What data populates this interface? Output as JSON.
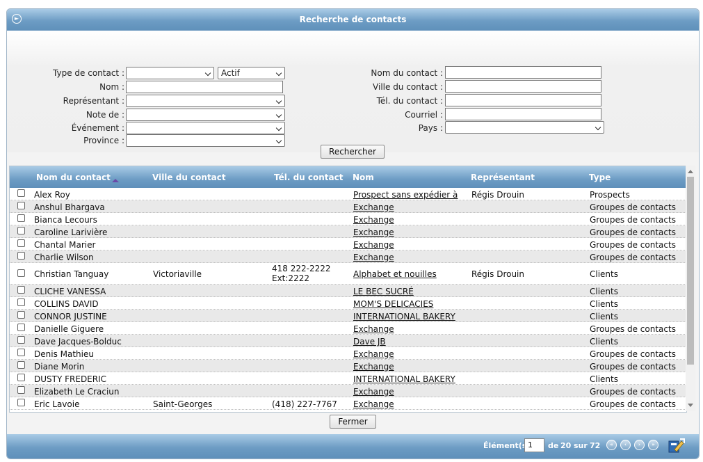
{
  "title": "Recherche de contacts",
  "form": {
    "type_label": "Type de contact :",
    "type_value": "",
    "status_value": "Actif",
    "nom_label": "Nom :",
    "nom_value": "",
    "rep_label": "Représentant :",
    "rep_value": "",
    "note_label": "Note de :",
    "note_value": "",
    "event_label": "Événement :",
    "event_value": "",
    "province_label": "Province :",
    "province_value": "",
    "contact_name_label": "Nom du contact :",
    "contact_name_value": "",
    "city_label": "Ville du contact :",
    "city_value": "",
    "phone_label": "Tél. du contact :",
    "phone_value": "",
    "email_label": "Courriel :",
    "email_value": "",
    "country_label": "Pays :",
    "country_value": "",
    "search_button": "Rechercher"
  },
  "grid": {
    "columns": [
      "Nom du contact",
      "Ville du contact",
      "Tél. du contact",
      "Nom",
      "Représentant",
      "Type"
    ],
    "rows": [
      {
        "contact": "Alex Roy",
        "city": "",
        "phone": "",
        "phone2": "",
        "nom": "Prospect sans expédier à",
        "rep": "Régis Drouin",
        "type": "Prospects"
      },
      {
        "contact": "Anshul Bhargava",
        "city": "",
        "phone": "",
        "phone2": "",
        "nom": "Exchange",
        "rep": "",
        "type": "Groupes de contacts"
      },
      {
        "contact": "Bianca Lecours",
        "city": "",
        "phone": "",
        "phone2": "",
        "nom": "Exchange",
        "rep": "",
        "type": "Groupes de contacts"
      },
      {
        "contact": "Caroline Larivière",
        "city": "",
        "phone": "",
        "phone2": "",
        "nom": "Exchange",
        "rep": "",
        "type": "Groupes de contacts"
      },
      {
        "contact": "Chantal Marier",
        "city": "",
        "phone": "",
        "phone2": "",
        "nom": "Exchange",
        "rep": "",
        "type": "Groupes de contacts"
      },
      {
        "contact": "Charlie Wilson",
        "city": "",
        "phone": "",
        "phone2": "",
        "nom": "Exchange",
        "rep": "",
        "type": "Groupes de contacts"
      },
      {
        "contact": "Christian Tanguay",
        "city": "Victoriaville",
        "phone": "418 222-2222",
        "phone2": "Ext:2222",
        "nom": "Alphabet et nouilles",
        "rep": "Régis Drouin",
        "type": "Clients"
      },
      {
        "contact": "CLICHE VANESSA",
        "city": "",
        "phone": "",
        "phone2": "",
        "nom": "LE BEC SUCRÉ",
        "rep": "",
        "type": "Clients"
      },
      {
        "contact": "COLLINS DAVID",
        "city": "",
        "phone": "",
        "phone2": "",
        "nom": "MOM'S DELICACIES",
        "rep": "",
        "type": "Clients"
      },
      {
        "contact": "CONNOR JUSTINE",
        "city": "",
        "phone": "",
        "phone2": "",
        "nom": "INTERNATIONAL BAKERY",
        "rep": "",
        "type": "Clients"
      },
      {
        "contact": "Danielle Giguere",
        "city": "",
        "phone": "",
        "phone2": "",
        "nom": "Exchange",
        "rep": "",
        "type": "Groupes de contacts"
      },
      {
        "contact": "Dave Jacques-Bolduc",
        "city": "",
        "phone": "",
        "phone2": "",
        "nom": "Dave JB",
        "rep": "",
        "type": "Clients"
      },
      {
        "contact": "Denis Mathieu",
        "city": "",
        "phone": "",
        "phone2": "",
        "nom": "Exchange",
        "rep": "",
        "type": "Groupes de contacts"
      },
      {
        "contact": "Diane Morin",
        "city": "",
        "phone": "",
        "phone2": "",
        "nom": "Exchange",
        "rep": "",
        "type": "Groupes de contacts"
      },
      {
        "contact": "DUSTY FREDERIC",
        "city": "",
        "phone": "",
        "phone2": "",
        "nom": "INTERNATIONAL BAKERY",
        "rep": "",
        "type": "Clients"
      },
      {
        "contact": "Elizabeth Le Craciun",
        "city": "",
        "phone": "",
        "phone2": "",
        "nom": "Exchange",
        "rep": "",
        "type": "Groupes de contacts"
      },
      {
        "contact": "Eric Lavoie",
        "city": "Saint-Georges",
        "phone": "(418) 227-7767",
        "phone2": "",
        "nom": "Exchange",
        "rep": "",
        "type": "Groupes de contacts"
      }
    ]
  },
  "close_button": "Fermer",
  "footer": {
    "elements_label": "Élément(s)",
    "page_value": "1",
    "de_label": "de",
    "page_size": "20",
    "sur_label": "sur",
    "total": "72"
  },
  "icons": {
    "collapse": "collapse-circle-icon",
    "sort": "sort-ascending-icon",
    "first": "first-page-icon",
    "prev": "previous-page-icon",
    "next": "next-page-icon",
    "last": "last-page-icon",
    "export": "export-icon"
  },
  "colors": {
    "header_blue": "#6d9cc4",
    "header_light": "#a9cbe6",
    "row_alt": "#e9e9e9"
  }
}
